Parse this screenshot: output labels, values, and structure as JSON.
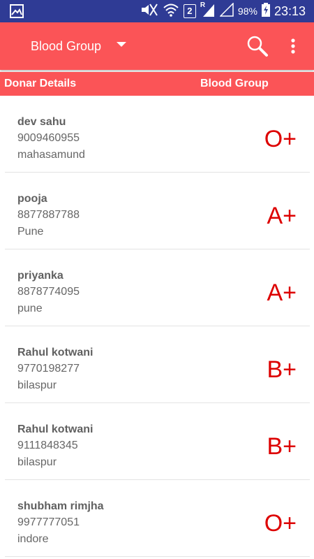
{
  "status_bar": {
    "battery": "98%",
    "time": "23:13",
    "sim_slot": "2",
    "roaming": "R"
  },
  "app_bar": {
    "spinner_selected": "Blood Group"
  },
  "table_header": {
    "left": "Donar Details",
    "right": "Blood Group"
  },
  "donors": [
    {
      "name": "dev sahu",
      "phone": "9009460955",
      "city": "mahasamund",
      "blood_group": "O+"
    },
    {
      "name": "pooja",
      "phone": "8877887788",
      "city": "Pune",
      "blood_group": "A+"
    },
    {
      "name": "priyanka",
      "phone": "8878774095",
      "city": "pune",
      "blood_group": "A+"
    },
    {
      "name": "Rahul kotwani",
      "phone": "9770198277",
      "city": "bilaspur",
      "blood_group": "B+"
    },
    {
      "name": "Rahul kotwani",
      "phone": "9111848345",
      "city": "bilaspur",
      "blood_group": "B+"
    },
    {
      "name": "shubham rimjha",
      "phone": "9977777051",
      "city": "indore",
      "blood_group": "O+"
    }
  ],
  "colors": {
    "app_bar": "#fb5457",
    "status_bar": "#2f3b95",
    "blood_group_text": "#dd0000"
  }
}
